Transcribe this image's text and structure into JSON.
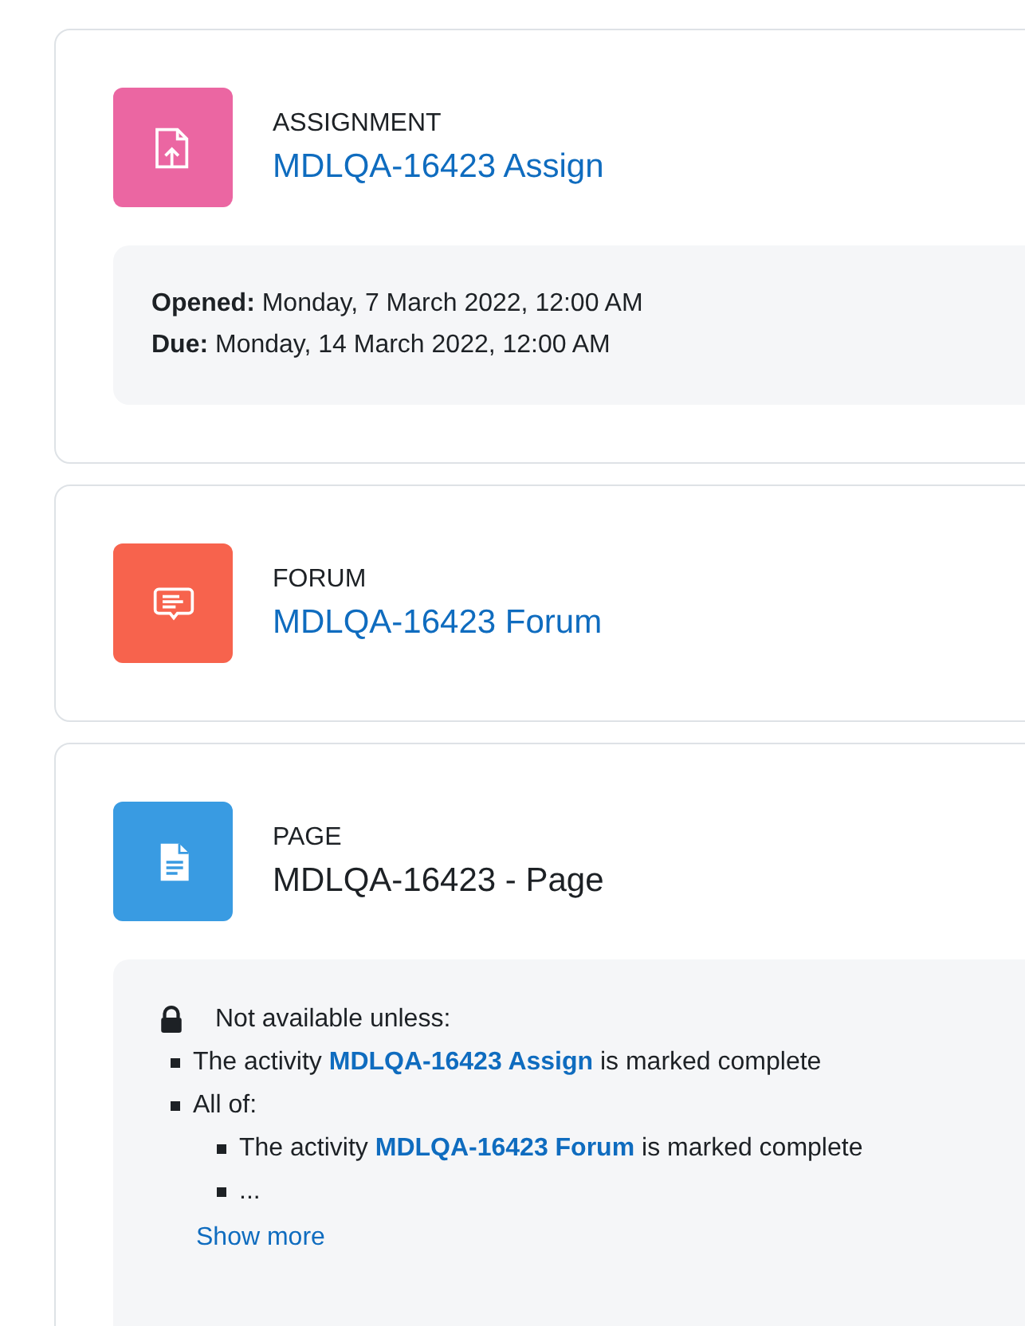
{
  "activities": [
    {
      "kind": "assign",
      "type": "ASSIGNMENT",
      "name": "MDLQA-16423 Assign",
      "linked": true,
      "dates": [
        {
          "label": "Opened:",
          "value": "Monday, 7 March 2022, 12:00 AM"
        },
        {
          "label": "Due:",
          "value": "Monday, 14 March 2022, 12:00 AM"
        }
      ]
    },
    {
      "kind": "forum",
      "type": "FORUM",
      "name": "MDLQA-16423 Forum",
      "linked": true
    },
    {
      "kind": "page",
      "type": "PAGE",
      "name": "MDLQA-16423 - Page",
      "linked": false,
      "restriction": {
        "heading": "Not available unless:",
        "items": [
          {
            "prefix": "The activity ",
            "link": "MDLQA-16423 Assign",
            "suffix": " is marked complete"
          },
          {
            "prefix": "All of:",
            "children": [
              {
                "prefix": "The activity ",
                "link": "MDLQA-16423 Forum",
                "suffix": " is marked complete"
              },
              {
                "prefix": "..."
              }
            ]
          }
        ],
        "show_more": "Show more"
      }
    }
  ]
}
